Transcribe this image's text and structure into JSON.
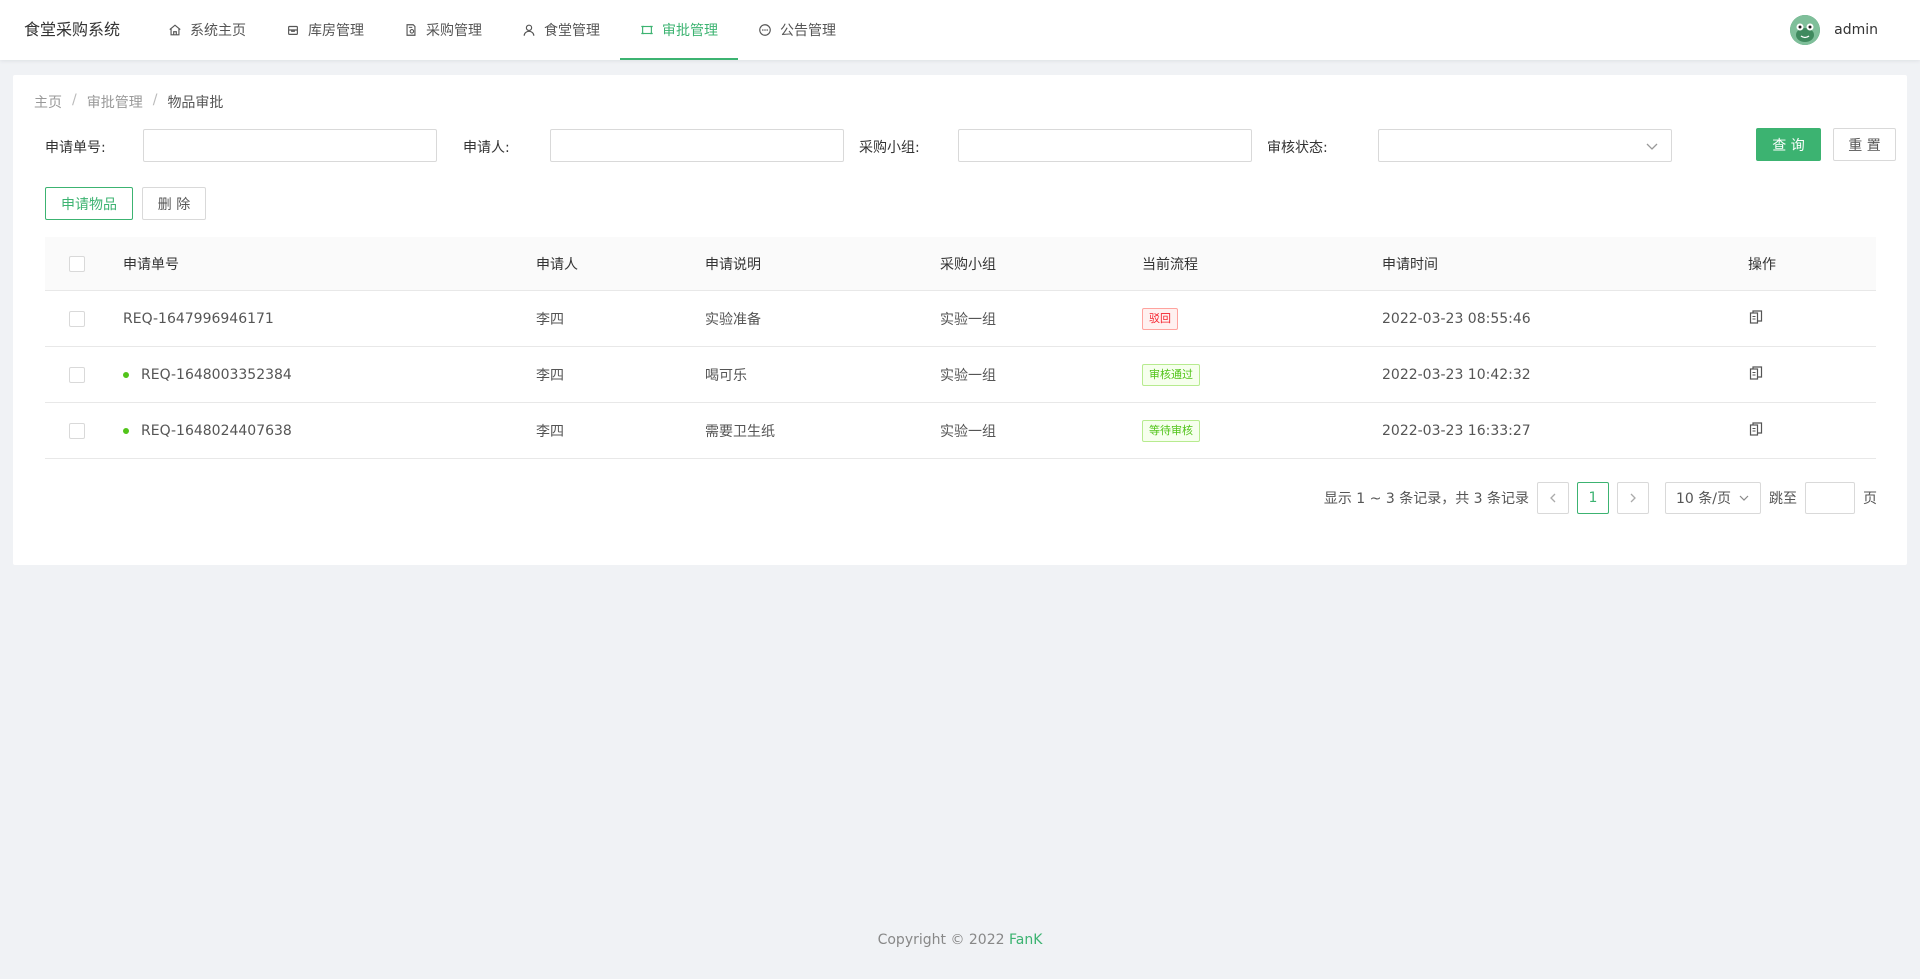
{
  "app": {
    "title": "食堂采购系统"
  },
  "nav": [
    {
      "label": "系统主页",
      "icon": "home-icon"
    },
    {
      "label": "库房管理",
      "icon": "box-icon"
    },
    {
      "label": "采购管理",
      "icon": "document-icon"
    },
    {
      "label": "食堂管理",
      "icon": "user-icon"
    },
    {
      "label": "审批管理",
      "icon": "approval-icon",
      "active": true
    },
    {
      "label": "公告管理",
      "icon": "message-icon"
    }
  ],
  "user": {
    "name": "admin"
  },
  "breadcrumb": {
    "home": "主页",
    "section": "审批管理",
    "current": "物品审批",
    "sep": "/"
  },
  "search": {
    "id_label": "申请单号:",
    "user_label": "申请人:",
    "group_label": "采购小组:",
    "status_label": "审核状态:",
    "query_btn": "查 询",
    "reset_btn": "重 置"
  },
  "actions": {
    "apply_btn": "申请物品",
    "delete_btn": "删 除"
  },
  "table": {
    "headers": [
      "申请单号",
      "申请人",
      "申请说明",
      "采购小组",
      "当前流程",
      "申请时间",
      "操作"
    ],
    "rows": [
      {
        "id": "REQ-1647996946171",
        "user": "李四",
        "desc": "实验准备",
        "group": "实验一组",
        "flow": "驳回",
        "flow_type": "red",
        "time": "2022-03-23 08:55:46",
        "dot": false
      },
      {
        "id": "REQ-1648003352384",
        "user": "李四",
        "desc": "喝可乐",
        "group": "实验一组",
        "flow": "审核通过",
        "flow_type": "green",
        "time": "2022-03-23 10:42:32",
        "dot": true
      },
      {
        "id": "REQ-1648024407638",
        "user": "李四",
        "desc": "需要卫生纸",
        "group": "实验一组",
        "flow": "等待审核",
        "flow_type": "green",
        "time": "2022-03-23 16:33:27",
        "dot": true
      }
    ]
  },
  "pagination": {
    "summary": "显示 1 ~ 3 条记录，共 3 条记录",
    "current_page": "1",
    "page_size": "10 条/页",
    "jump_label": "跳至",
    "page_unit": "页"
  },
  "footer": {
    "copyright": "Copyright © 2022",
    "brand": "FanK"
  },
  "colors": {
    "accent": "#3cb371",
    "reject": "#f5222d",
    "pass": "#52c41a"
  }
}
